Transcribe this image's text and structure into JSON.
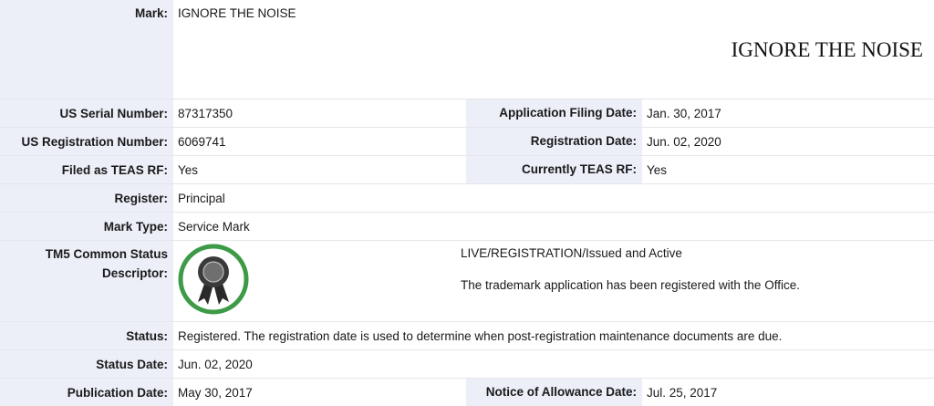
{
  "mark": {
    "label": "Mark:",
    "value": "IGNORE THE NOISE",
    "image_text": "IGNORE THE NOISE"
  },
  "serial": {
    "label": "US Serial Number:",
    "value": "87317350"
  },
  "filing_date": {
    "label": "Application Filing Date:",
    "value": "Jan. 30, 2017"
  },
  "registration_number": {
    "label": "US Registration Number:",
    "value": "6069741"
  },
  "registration_date": {
    "label": "Registration Date:",
    "value": "Jun. 02, 2020"
  },
  "filed_teas": {
    "label": "Filed as TEAS RF:",
    "value": "Yes"
  },
  "current_teas": {
    "label": "Currently TEAS RF:",
    "value": "Yes"
  },
  "register": {
    "label": "Register:",
    "value": "Principal"
  },
  "mark_type": {
    "label": "Mark Type:",
    "value": "Service Mark"
  },
  "tm5": {
    "label_line1": "TM5 Common Status",
    "label_line2": "Descriptor:",
    "badge_icon": "registered-ribbon-icon",
    "badge_color": "#3d9a47",
    "status": "LIVE/REGISTRATION/Issued and Active",
    "description": "The trademark application has been registered with the Office."
  },
  "status": {
    "label": "Status:",
    "value": "Registered. The registration date is used to determine when post-registration maintenance documents are due."
  },
  "status_date": {
    "label": "Status Date:",
    "value": "Jun. 02, 2020"
  },
  "publication_date": {
    "label": "Publication Date:",
    "value": "May 30, 2017"
  },
  "allowance_date": {
    "label": "Notice of Allowance Date:",
    "value": "Jul. 25, 2017"
  }
}
